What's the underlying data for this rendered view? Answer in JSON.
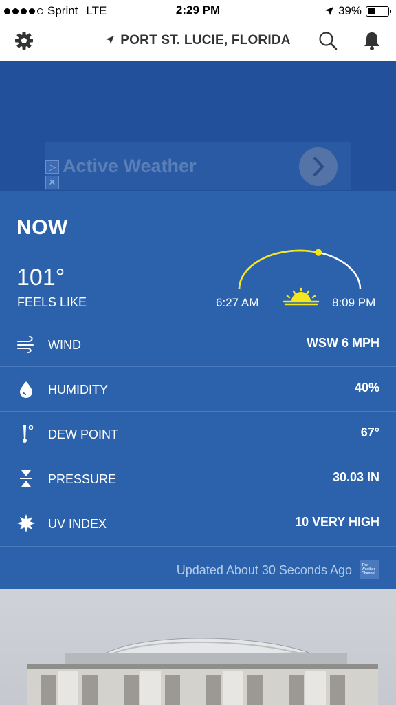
{
  "status_bar": {
    "carrier": "Sprint",
    "network": "LTE",
    "time": "2:29 PM",
    "battery": "39%",
    "battery_level": 0.39,
    "signal_bars": 4
  },
  "header": {
    "location": "PORT ST. LUCIE, FLORIDA",
    "icons": [
      "gear-icon",
      "location-arrow-icon",
      "search-icon",
      "bell-icon"
    ]
  },
  "ad": {
    "text": "Active Weather"
  },
  "now": {
    "title": "NOW",
    "temperature": "101°",
    "feels_like_label": "FEELS LIKE",
    "sunrise": "6:27 AM",
    "sunset": "8:09 PM",
    "sun_progress": 0.6
  },
  "details": [
    {
      "icon": "wind-icon",
      "label": "WIND",
      "value": "WSW 6 MPH"
    },
    {
      "icon": "humidity-drop-icon",
      "label": "HUMIDITY",
      "value": "40%"
    },
    {
      "icon": "dew-point-icon",
      "label": "DEW POINT",
      "value": "67°"
    },
    {
      "icon": "pressure-icon",
      "label": "PRESSURE",
      "value": "30.03 IN"
    },
    {
      "icon": "uv-sun-icon",
      "label": "UV INDEX",
      "value": "10 VERY HIGH"
    }
  ],
  "footer": {
    "updated": "Updated About 30 Seconds Ago",
    "logo_text": "The Weather Channel"
  },
  "colors": {
    "panel_bg": "#2c62ab",
    "ad_bg": "#23509b",
    "sun_yellow": "#f5e71c"
  }
}
